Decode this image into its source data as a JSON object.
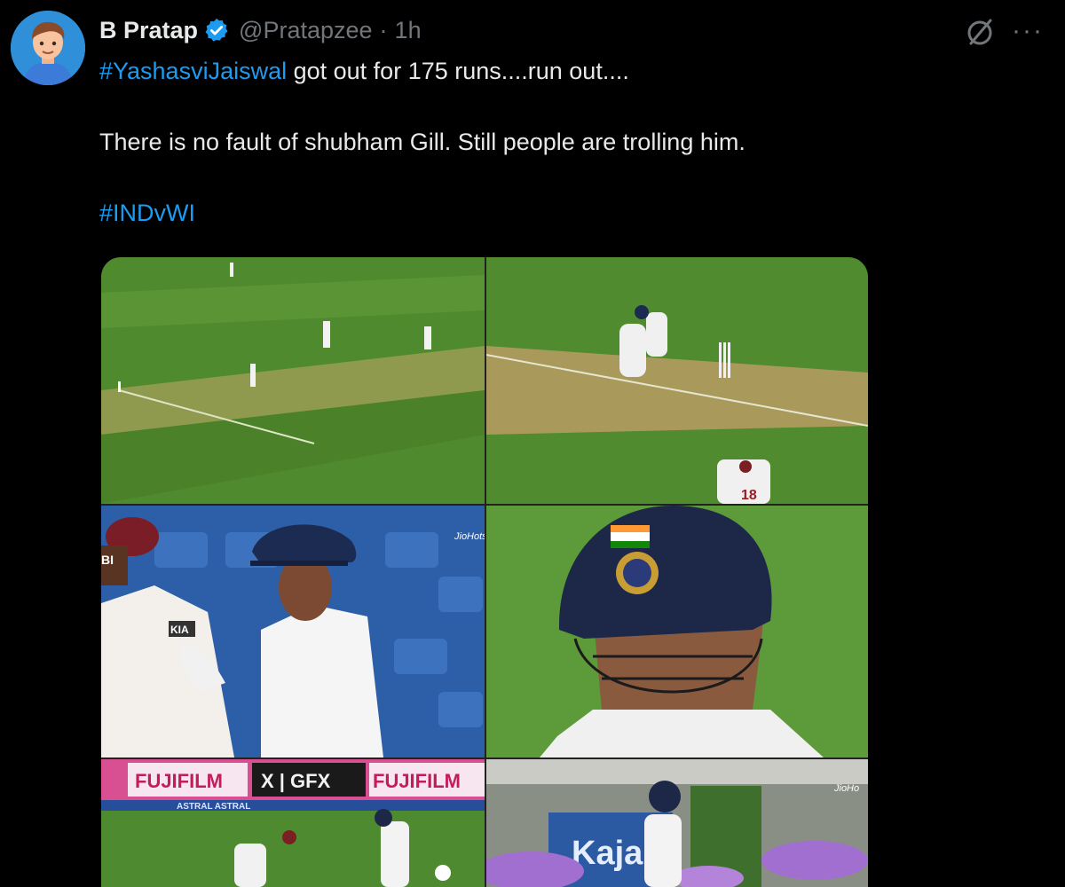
{
  "post": {
    "author_name": "B Pratap",
    "handle": "@Pratapzee",
    "separator": "·",
    "time": "1h",
    "text_hashtag": "#YashasviJaiswal",
    "text_line1": " got out for 175 runs....run out....",
    "text_line2": "There is no fault of shubham Gill. Still people are trolling him.",
    "text_hashtag2": "#INDvWI"
  },
  "actions": {
    "more_label": "···"
  },
  "media": {
    "watermark": "JioHotstar",
    "watermark_short": "JioHo",
    "board_left": "FUJIFILM",
    "board_mid": "X | GFX",
    "board_right": "FUJIFILM",
    "board_strip": "ASTRAL  ASTRAL",
    "stand_text": "Kajar",
    "jersey_number": "18",
    "sponsor_badge": "KIA",
    "left_edge_badge": "BI"
  },
  "colors": {
    "accent": "#1d9bf0",
    "muted": "#71767b",
    "text": "#e7e9ea",
    "background": "#000000"
  },
  "icons": [
    "avatar-icon",
    "verified-badge-icon",
    "grok-icon",
    "more-icon"
  ]
}
